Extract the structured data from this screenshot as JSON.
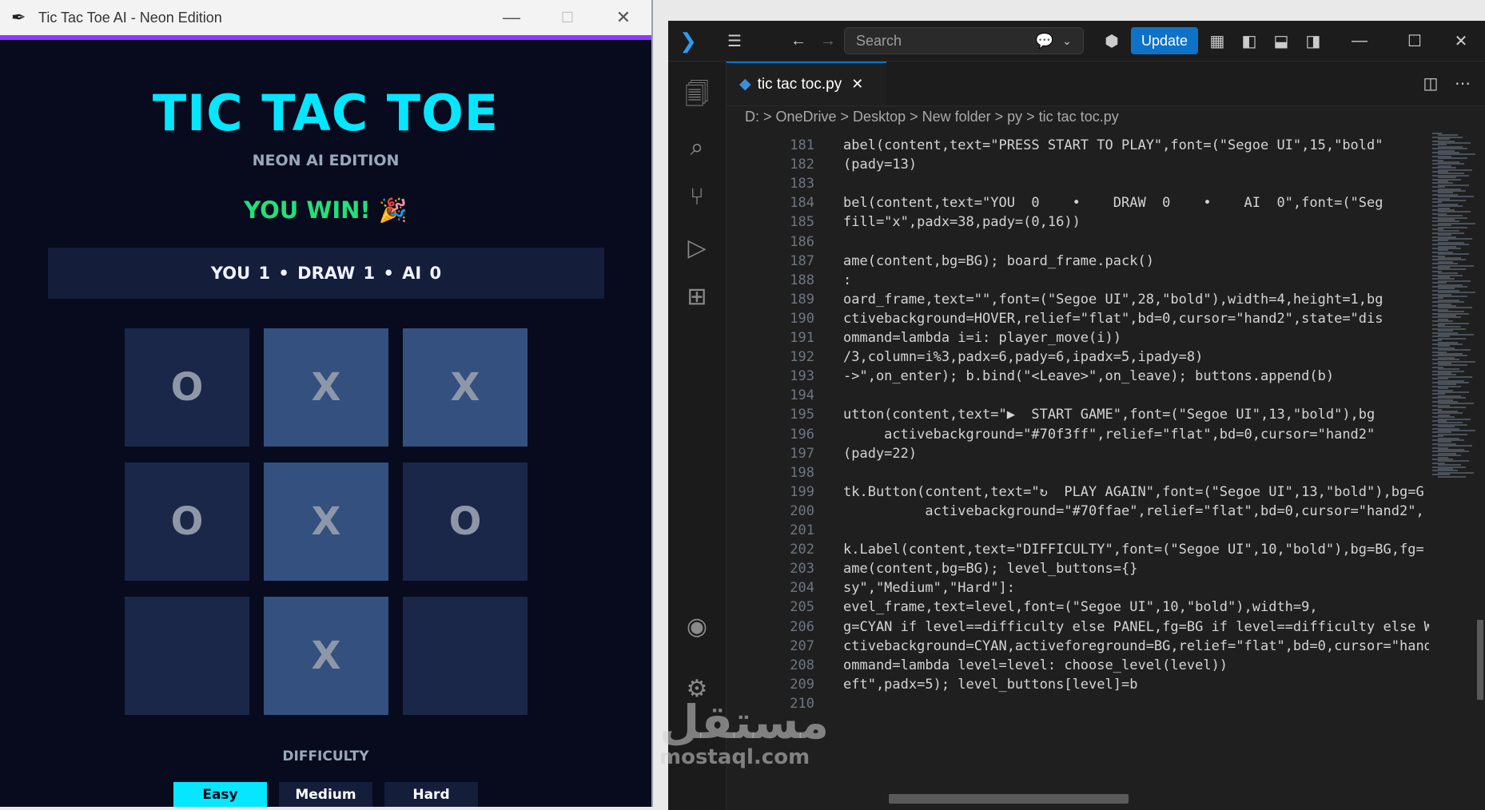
{
  "game_window": {
    "title": "Tic Tac Toe AI - Neon Edition",
    "heading": "TIC TAC TOE",
    "subheading": "NEON AI EDITION",
    "status": "YOU WIN! 🎉",
    "score": "YOU 1  •  DRAW 1  •  AI 0",
    "board": [
      "O",
      "X",
      "X",
      "O",
      "X",
      "O",
      "",
      "X",
      ""
    ],
    "difficulty_label": "DIFFICULTY",
    "levels": [
      "Easy",
      "Medium",
      "Hard"
    ],
    "selected_level": "Easy",
    "colors": {
      "accent": "#06e6ff",
      "win": "#22e07a",
      "bg": "#070b1d",
      "panel": "#141d3a",
      "title_bar_accent": "#8b3cff"
    }
  },
  "vscode": {
    "search_placeholder": "Search",
    "update_label": "Update",
    "tab_title": "tic tac toc.py",
    "breadcrumb": "D: > OneDrive > Desktop > New folder > py > tic tac toc.py",
    "line_numbers": [
      "181",
      "182",
      "183",
      "184",
      "185",
      "186",
      "187",
      "188",
      "189",
      "190",
      "191",
      "192",
      "193",
      "194",
      "195",
      "196",
      "197",
      "198",
      "199",
      "200",
      "201",
      "202",
      "203",
      "204",
      "205",
      "206",
      "207",
      "208",
      "209",
      "210"
    ],
    "lines": [
      "abel(content,text=\"PRESS START TO PLAY\",font=(\"Segoe UI\",15,\"bold\"",
      "(pady=13)",
      "",
      "bel(content,text=\"YOU  0    •    DRAW  0    •    AI  0\",font=(\"Seg",
      "fill=\"x\",padx=38,pady=(0,16))",
      "",
      "ame(content,bg=BG); board_frame.pack()",
      ":",
      "oard_frame,text=\"\",font=(\"Segoe UI\",28,\"bold\"),width=4,height=1,bg",
      "ctivebackground=HOVER,relief=\"flat\",bd=0,cursor=\"hand2\",state=\"dis",
      "ommand=lambda i=i: player_move(i))",
      "/3,column=i%3,padx=6,pady=6,ipadx=5,ipady=8)",
      "->\",on_enter); b.bind(\"<Leave>\",on_leave); buttons.append(b)",
      "",
      "utton(content,text=\"▶  START GAME\",font=(\"Segoe UI\",13,\"bold\"),bg",
      "     activebackground=\"#70f3ff\",relief=\"flat\",bd=0,cursor=\"hand2\"",
      "(pady=22)",
      "",
      "tk.Button(content,text=\"↻  PLAY AGAIN\",font=(\"Segoe UI\",13,\"bold\"),bg=G",
      "          activebackground=\"#70ffae\",relief=\"flat\",bd=0,cursor=\"hand2\",",
      "",
      "k.Label(content,text=\"DIFFICULTY\",font=(\"Segoe UI\",10,\"bold\"),bg=BG,fg=",
      "ame(content,bg=BG); level_buttons={}",
      "sy\",\"Medium\",\"Hard\"]:",
      "evel_frame,text=level,font=(\"Segoe UI\",10,\"bold\"),width=9,",
      "g=CYAN if level==difficulty else PANEL,fg=BG if level==difficulty else W",
      "ctivebackground=CYAN,activeforeground=BG,relief=\"flat\",bd=0,cursor=\"hand",
      "ommand=lambda level=level: choose_level(level))",
      "eft\",padx=5); level_buttons[level]=b",
      ""
    ]
  },
  "watermark": {
    "arabic": "مستقل",
    "latin": "mostaql.com"
  }
}
